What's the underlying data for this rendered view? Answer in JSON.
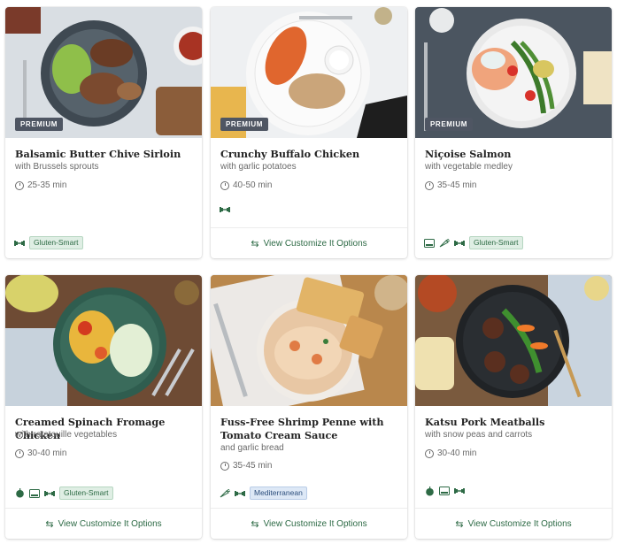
{
  "cards": [
    {
      "title": "Balsamic Butter Chive Sirloin",
      "subtitle": "with Brussels sprouts",
      "time": "25-35 min",
      "premium": "PREMIUM",
      "tag": "Gluten-Smart",
      "cta": ""
    },
    {
      "title": "Crunchy Buffalo Chicken",
      "subtitle": "with garlic potatoes",
      "time": "40-50 min",
      "premium": "PREMIUM",
      "tag": "",
      "cta": "View Customize It Options"
    },
    {
      "title": "Niçoise Salmon",
      "subtitle": "with vegetable medley",
      "time": "35-45 min",
      "premium": "PREMIUM",
      "tag": "Gluten-Smart",
      "cta": ""
    },
    {
      "title": "Creamed Spinach Fromage Chicken",
      "subtitle": "with ratatouille vegetables",
      "time": "30-40 min",
      "premium": "",
      "tag": "Gluten-Smart",
      "cta": "View Customize It Options"
    },
    {
      "title": "Fuss-Free Shrimp Penne with Tomato Cream Sauce",
      "subtitle": "and garlic bread",
      "time": "35-45 min",
      "premium": "",
      "tag": "Mediterranean",
      "cta": "View Customize It Options"
    },
    {
      "title": "Katsu Pork Meatballs",
      "subtitle": "with snow peas and carrots",
      "time": "30-40 min",
      "premium": "",
      "tag": "",
      "cta": "View Customize It Options"
    }
  ],
  "icons": {
    "protein": "dumbbell-icon",
    "calories": "scale-icon",
    "veggie": "carrot-icon",
    "apple": "apple-icon"
  },
  "colors": {
    "accent_green": "#2d6a45",
    "badge_bg": "#4f5663"
  }
}
